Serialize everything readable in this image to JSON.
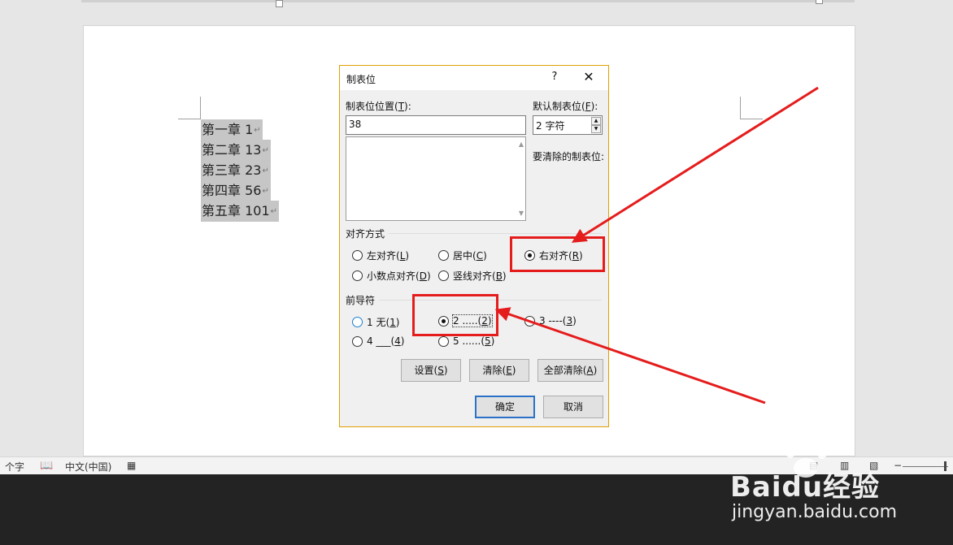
{
  "document": {
    "lines": [
      {
        "text": "第一章 1"
      },
      {
        "text": "第二章 13"
      },
      {
        "text": "第三章 23"
      },
      {
        "text": "第四章 56"
      },
      {
        "text": "第五章 101"
      }
    ],
    "paragraph_mark": "↵"
  },
  "dialog": {
    "title": "制表位",
    "help_label": "?",
    "close_label": "✕",
    "tab_position": {
      "label_prefix": "制表位位置(",
      "label_key": "T",
      "label_suffix": "):",
      "value": "38"
    },
    "default_tab": {
      "label_prefix": "默认制表位(",
      "label_key": "F",
      "label_suffix": "):",
      "value": "2 字符"
    },
    "clear_label": "要清除的制表位:",
    "alignment": {
      "title": "对齐方式",
      "options": [
        {
          "prefix": "左对齐(",
          "key": "L",
          "suffix": ")",
          "selected": false
        },
        {
          "prefix": "居中(",
          "key": "C",
          "suffix": ")",
          "selected": false
        },
        {
          "prefix": "右对齐(",
          "key": "R",
          "suffix": ")",
          "selected": true
        },
        {
          "prefix": "小数点对齐(",
          "key": "D",
          "suffix": ")",
          "selected": false
        },
        {
          "prefix": "竖线对齐(",
          "key": "B",
          "suffix": ")",
          "selected": false
        }
      ]
    },
    "leader": {
      "title": "前导符",
      "options": [
        {
          "prefix": "1 无(",
          "key": "1",
          "suffix": ")",
          "selected": false
        },
        {
          "prefix": "2 .....(",
          "key": "2",
          "suffix": ")",
          "selected": true
        },
        {
          "prefix": "3 ----(",
          "key": "3",
          "suffix": ")",
          "selected": false
        },
        {
          "prefix": "4 ___(",
          "key": "4",
          "suffix": ")",
          "selected": false
        },
        {
          "prefix": "5 ......(",
          "key": "5",
          "suffix": ")",
          "selected": false
        }
      ]
    },
    "buttons": {
      "set": {
        "prefix": "设置(",
        "key": "S",
        "suffix": ")"
      },
      "clear": {
        "prefix": "清除(",
        "key": "E",
        "suffix": ")"
      },
      "clear_all": {
        "prefix": "全部清除(",
        "key": "A",
        "suffix": ")"
      },
      "ok": "确定",
      "cancel": "取消"
    }
  },
  "statusbar": {
    "word_count": "个字",
    "language": "中文(中国)"
  },
  "watermark": {
    "brand_left": "Bai",
    "brand_mid": "du",
    "brand_right": "经验",
    "url": "jingyan.baidu.com"
  },
  "colors": {
    "highlight_box": "#e51c1c",
    "dialog_border": "#e0a000",
    "default_button_border": "#2a72c8"
  }
}
